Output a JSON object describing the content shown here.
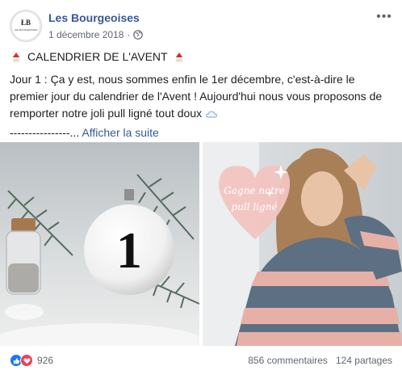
{
  "post": {
    "page_name": "Les Bourgeoises",
    "date": "1 décembre 2018",
    "privacy_icon": "globe-icon",
    "avatar_text": {
      "line1": "ŁB",
      "line2": "LES BOURGEOISES"
    },
    "title": "CALENDRIER DE L'AVENT",
    "body_lines": [
      "Jour 1 : Ça y est, nous sommes enfin le 1er décembre, c'est-à-dire le",
      "premier jour du calendrier de l'Avent ! Aujourd'hui nous vous proposons de",
      "remporter notre joli pull ligné tout doux"
    ],
    "ellipsis": "----------------...",
    "see_more": "Afficher la suite"
  },
  "images": {
    "left": {
      "ornament_number": "1"
    },
    "right": {
      "heart_text_line1": "Gagne notre",
      "heart_text_line2": "pull ligné"
    }
  },
  "footer": {
    "reactions_count": "926",
    "comments": "856 commentaires",
    "shares": "124 partages"
  },
  "colors": {
    "link": "#365899",
    "meta": "#606770",
    "like": "#1877f2",
    "love": "#f33e58"
  }
}
